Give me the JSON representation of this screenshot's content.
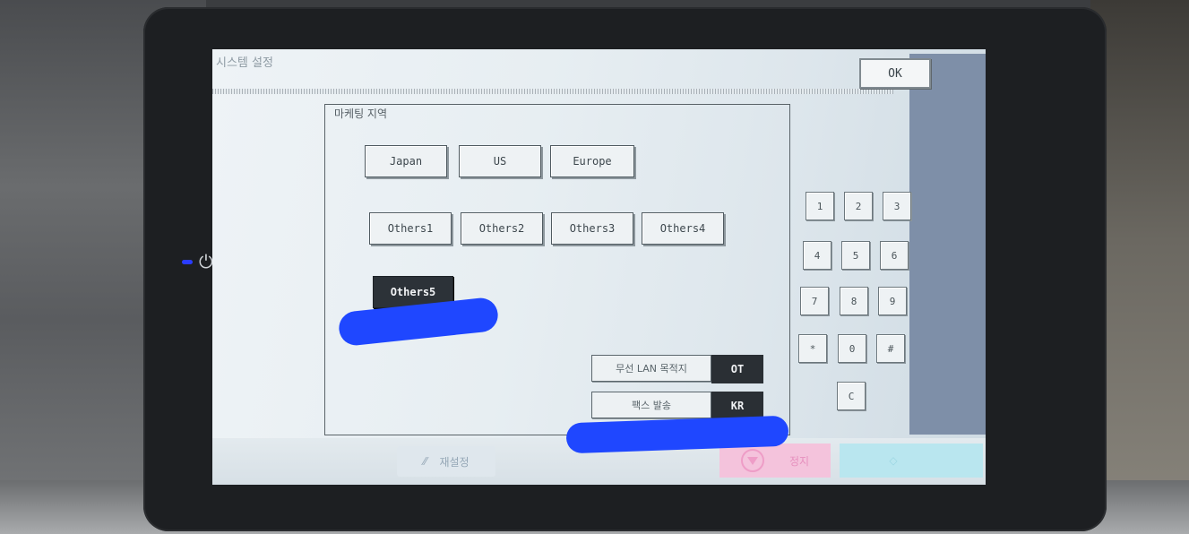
{
  "window": {
    "title": "시스템 설정"
  },
  "header": {
    "ok_label": "OK"
  },
  "panel": {
    "label": "마케팅 지역"
  },
  "regions": {
    "row1": [
      "Japan",
      "US",
      "Europe"
    ],
    "row2": [
      "Others1",
      "Others2",
      "Others3",
      "Others4"
    ],
    "row3": [
      "Others5"
    ],
    "selected": "Others5"
  },
  "destinations": [
    {
      "label": "무선 LAN 목적지",
      "value": "OT"
    },
    {
      "label": "팩스 발송",
      "value": "KR"
    }
  ],
  "keypad": {
    "keys": [
      "1",
      "2",
      "3",
      "4",
      "5",
      "6",
      "7",
      "8",
      "9",
      "*",
      "0",
      "#"
    ],
    "clear": "C"
  },
  "footer": {
    "reset_label": "재설정",
    "stop_label": "정지",
    "start_label": ""
  },
  "colors": {
    "selected_bg": "#2c3238",
    "stop_bg": "#f4c3dc",
    "start_bg": "#b9e6ef",
    "redaction": "#1f47ff"
  }
}
